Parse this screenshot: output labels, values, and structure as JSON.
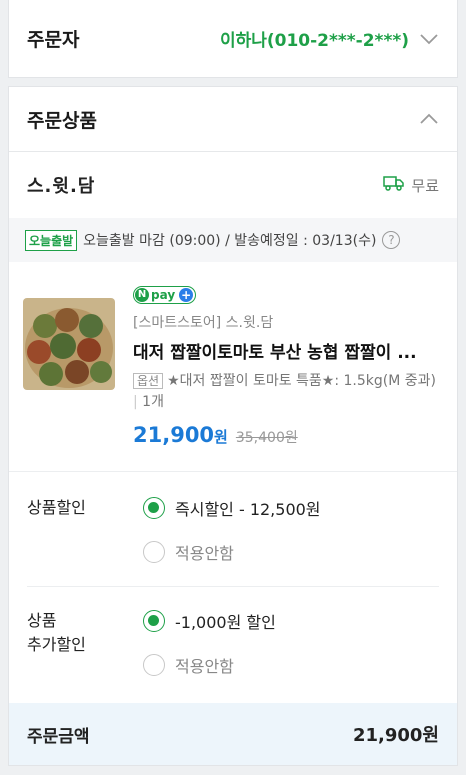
{
  "orderer": {
    "title": "주문자",
    "value": "이하나(010-2***-2***)"
  },
  "product_section": {
    "title": "주문상품"
  },
  "store": {
    "name": "스.윗.담",
    "shipping": "무료"
  },
  "notice": {
    "badge": "오늘출발",
    "text": "오늘출발 마감 (09:00) / 발송예정일 : 03/13(수)",
    "help": "?"
  },
  "item": {
    "npay_label": "pay",
    "seller": "[스마트스토어] 스.윗.담",
    "name": "대저 짭짤이토마토 부산 농협 짭짤이 ...",
    "option_tag": "옵션",
    "option_text": "★대저 짭짤이 토마토 특품★: 1.5kg(M 중과)",
    "quantity": "1개",
    "price": "21,900",
    "price_unit": "원",
    "original_price": "35,400원"
  },
  "discounts": [
    {
      "label": "상품할인",
      "options": [
        {
          "text": "즉시할인 - 12,500원",
          "selected": true
        },
        {
          "text": "적용안함",
          "selected": false
        }
      ]
    },
    {
      "label": "상품\n추가할인",
      "options": [
        {
          "text": "-1,000원 할인",
          "selected": true
        },
        {
          "text": "적용안함",
          "selected": false
        }
      ]
    }
  ],
  "total": {
    "label": "주문금액",
    "value": "21,900원"
  },
  "colors": {
    "accent_green": "#1ea048",
    "price_blue": "#1b7ad6"
  }
}
